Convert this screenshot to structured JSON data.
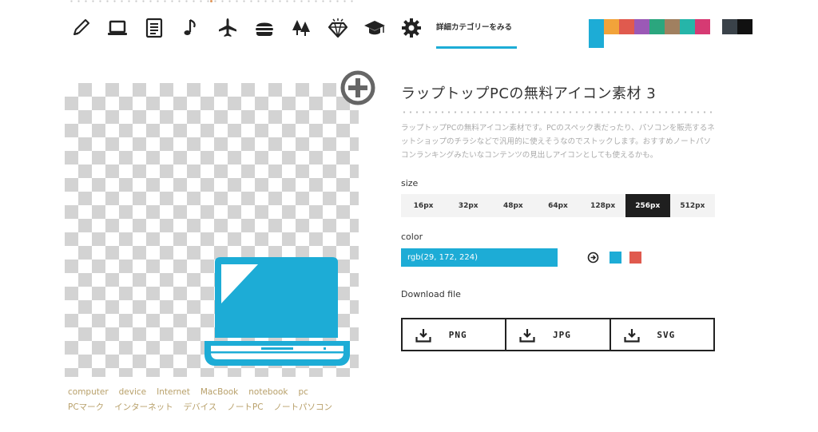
{
  "nav": {
    "icons": [
      "pencil-icon",
      "laptop-icon",
      "notebook-icon",
      "music-note-icon",
      "airplane-icon",
      "burger-icon",
      "trees-icon",
      "diamond-icon",
      "graduation-cap-icon",
      "gear-icon"
    ],
    "category_link": "詳細カテゴリーをみる"
  },
  "palette": [
    "#1dacd6",
    "#f2a33a",
    "#e05a4e",
    "#9b59b6",
    "#2ba67e",
    "#a08060",
    "#26b5a9",
    "#d63a73"
  ],
  "palette_dark": [
    "#3a4249",
    "#111111"
  ],
  "icon": {
    "title": "ラップトップPCの無料アイコン素材 3",
    "description": "ラップトップPCの無料アイコン素材です。PCのスペック表だったり、パソコンを販売するネットショップのチラシなどで汎用的に使えそうなのでストックします。おすすめノートパソコンランキングみたいなコンテンツの見出しアイコンとしても使えるかも。",
    "color": "#1dacd6"
  },
  "tags": [
    "computer",
    "device",
    "Internet",
    "MacBook",
    "notebook",
    "pc",
    "PCマーク",
    "インターネット",
    "デバイス",
    "ノートPC",
    "ノートパソコン"
  ],
  "size": {
    "label": "size",
    "options": [
      "16px",
      "32px",
      "48px",
      "64px",
      "128px",
      "256px",
      "512px"
    ],
    "selected": "256px"
  },
  "color_section": {
    "label": "color",
    "value": "rgb(29, 172, 224)",
    "swatch_blue": "#1dacd6",
    "swatch_red": "#e05a4e"
  },
  "download": {
    "label": "Download file",
    "buttons": [
      "PNG",
      "JPG",
      "SVG"
    ]
  }
}
